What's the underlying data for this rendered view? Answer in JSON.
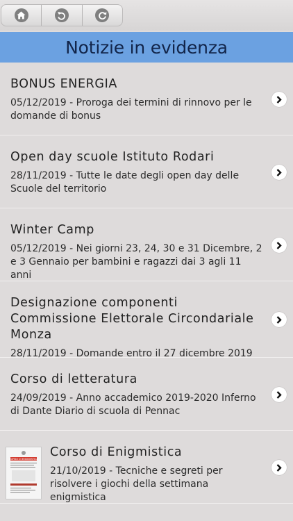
{
  "toolbar": {
    "buttons": [
      {
        "icon": "home-icon"
      },
      {
        "icon": "back-icon"
      },
      {
        "icon": "refresh-icon"
      }
    ]
  },
  "header": {
    "title": "Notizie in evidenza"
  },
  "news": [
    {
      "title": "BONUS ENERGIA",
      "description": "05/12/2019 - Proroga dei termini di rinnovo per le domande di bonus"
    },
    {
      "title": "Open day scuole Istituto Rodari",
      "description": "28/11/2019 - Tutte le date degli open day delle Scuole del territorio"
    },
    {
      "title": "Winter Camp",
      "description": "05/12/2019 - Nei giorni 23, 24, 30 e 31 Dicembre, 2 e 3 Gennaio per bambini e ragazzi dai 3 agli 11 anni"
    },
    {
      "title": "Designazione componenti Commissione Elettorale Circondariale Monza",
      "description": "28/11/2019 - Domande entro il 27 dicembre 2019"
    },
    {
      "title": "Corso di letteratura",
      "description": "24/09/2019 - Anno accademico 2019-2020 Inferno di Dante Diario di scuola di Pennac"
    },
    {
      "title": "Corso di Enigmistica",
      "description": "21/10/2019 - Tecniche e segreti per risolvere i giochi della settimana enigmistica",
      "thumbnail_heading": "CORSO DI ENIGMISTICA"
    }
  ],
  "colors": {
    "header_bg": "#6ba1e1",
    "header_text": "#12254a",
    "list_bg": "#dedbdb"
  }
}
